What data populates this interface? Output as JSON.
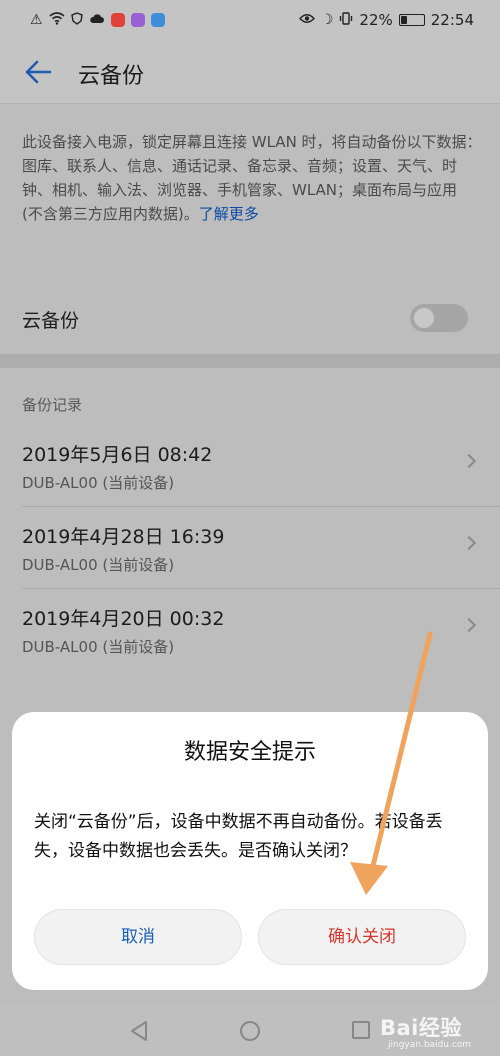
{
  "status_bar": {
    "battery": "22%",
    "time": "22:54",
    "icons_left": [
      "alert-icon",
      "wifi-icon",
      "shield-icon",
      "cloud-icon",
      "app-icon-red",
      "app-icon-purple",
      "app-icon-blue"
    ],
    "icons_right": [
      "eye-icon",
      "moon-icon",
      "vibrate-icon",
      "battery-icon"
    ]
  },
  "header": {
    "title": "云备份",
    "back_icon": "arrow-left-icon"
  },
  "description": {
    "text": "此设备接入电源，锁定屏幕且连接 WLAN 时，将自动备份以下数据：图库、联系人、信息、通话记录、备忘录、音频；设置、天气、时钟、相机、输入法、浏览器、手机管家、WLAN；桌面布局与应用 (不含第三方应用内数据)。",
    "link": "了解更多"
  },
  "cloud_backup_toggle": {
    "label": "云备份",
    "state": "off"
  },
  "backup_records": {
    "section_label": "备份记录",
    "items": [
      {
        "date": "2019年5月6日 08:42",
        "device": "DUB-AL00 (当前设备)"
      },
      {
        "date": "2019年4月28日 16:39",
        "device": "DUB-AL00 (当前设备)"
      },
      {
        "date": "2019年4月20日 00:32",
        "device": "DUB-AL00 (当前设备)"
      }
    ]
  },
  "dialog": {
    "title": "数据安全提示",
    "message": "关闭“云备份”后，设备中数据不再自动备份。若设备丢失，设备中数据也会丢失。是否确认关闭？",
    "cancel_label": "取消",
    "confirm_label": "确认关闭"
  },
  "nav_bar": {
    "icons": [
      "triangle-back-icon",
      "circle-home-icon",
      "square-recents-icon"
    ]
  },
  "watermark": {
    "main": "Bai经验",
    "sub": "jingyan.baidu.com"
  },
  "colors": {
    "link_blue": "#0a4aa6",
    "cancel_blue": "#1a5fb8",
    "confirm_red": "#d6372b",
    "annotation_arrow": "#f0a35c"
  }
}
